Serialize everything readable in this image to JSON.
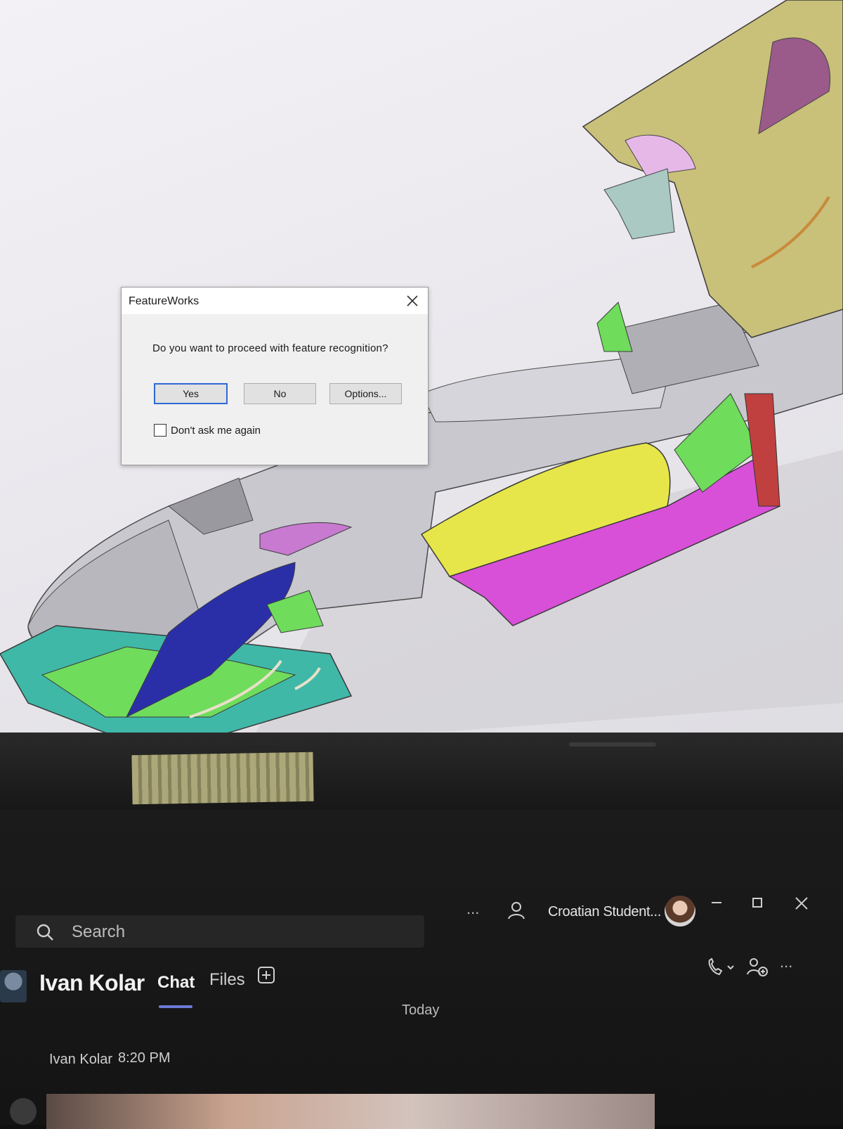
{
  "dialog": {
    "title": "FeatureWorks",
    "message": "Do you want to proceed with feature recognition?",
    "buttons": {
      "yes": "Yes",
      "no": "No",
      "options": "Options..."
    },
    "checkbox_label": "Don't ask me again",
    "checkbox_checked": false
  },
  "teams": {
    "search_placeholder": "Search",
    "org_name": "Croatian Student...",
    "chat_name": "Ivan Kolar",
    "tabs": {
      "chat": "Chat",
      "files": "Files"
    },
    "date_divider": "Today",
    "message": {
      "sender": "Ivan Kolar",
      "time": "8:20 PM"
    },
    "more_label": "..."
  },
  "colors": {
    "accent_blue": "#2f68d4",
    "teams_tab_underline": "#6c7bd8",
    "cad_yellow": "#e6e64a",
    "cad_magenta": "#d84fd8",
    "cad_green": "#6fdc5c",
    "cad_teal": "#3fb8a8",
    "cad_navy": "#2a2fa8",
    "cad_khaki": "#c9c07a"
  }
}
